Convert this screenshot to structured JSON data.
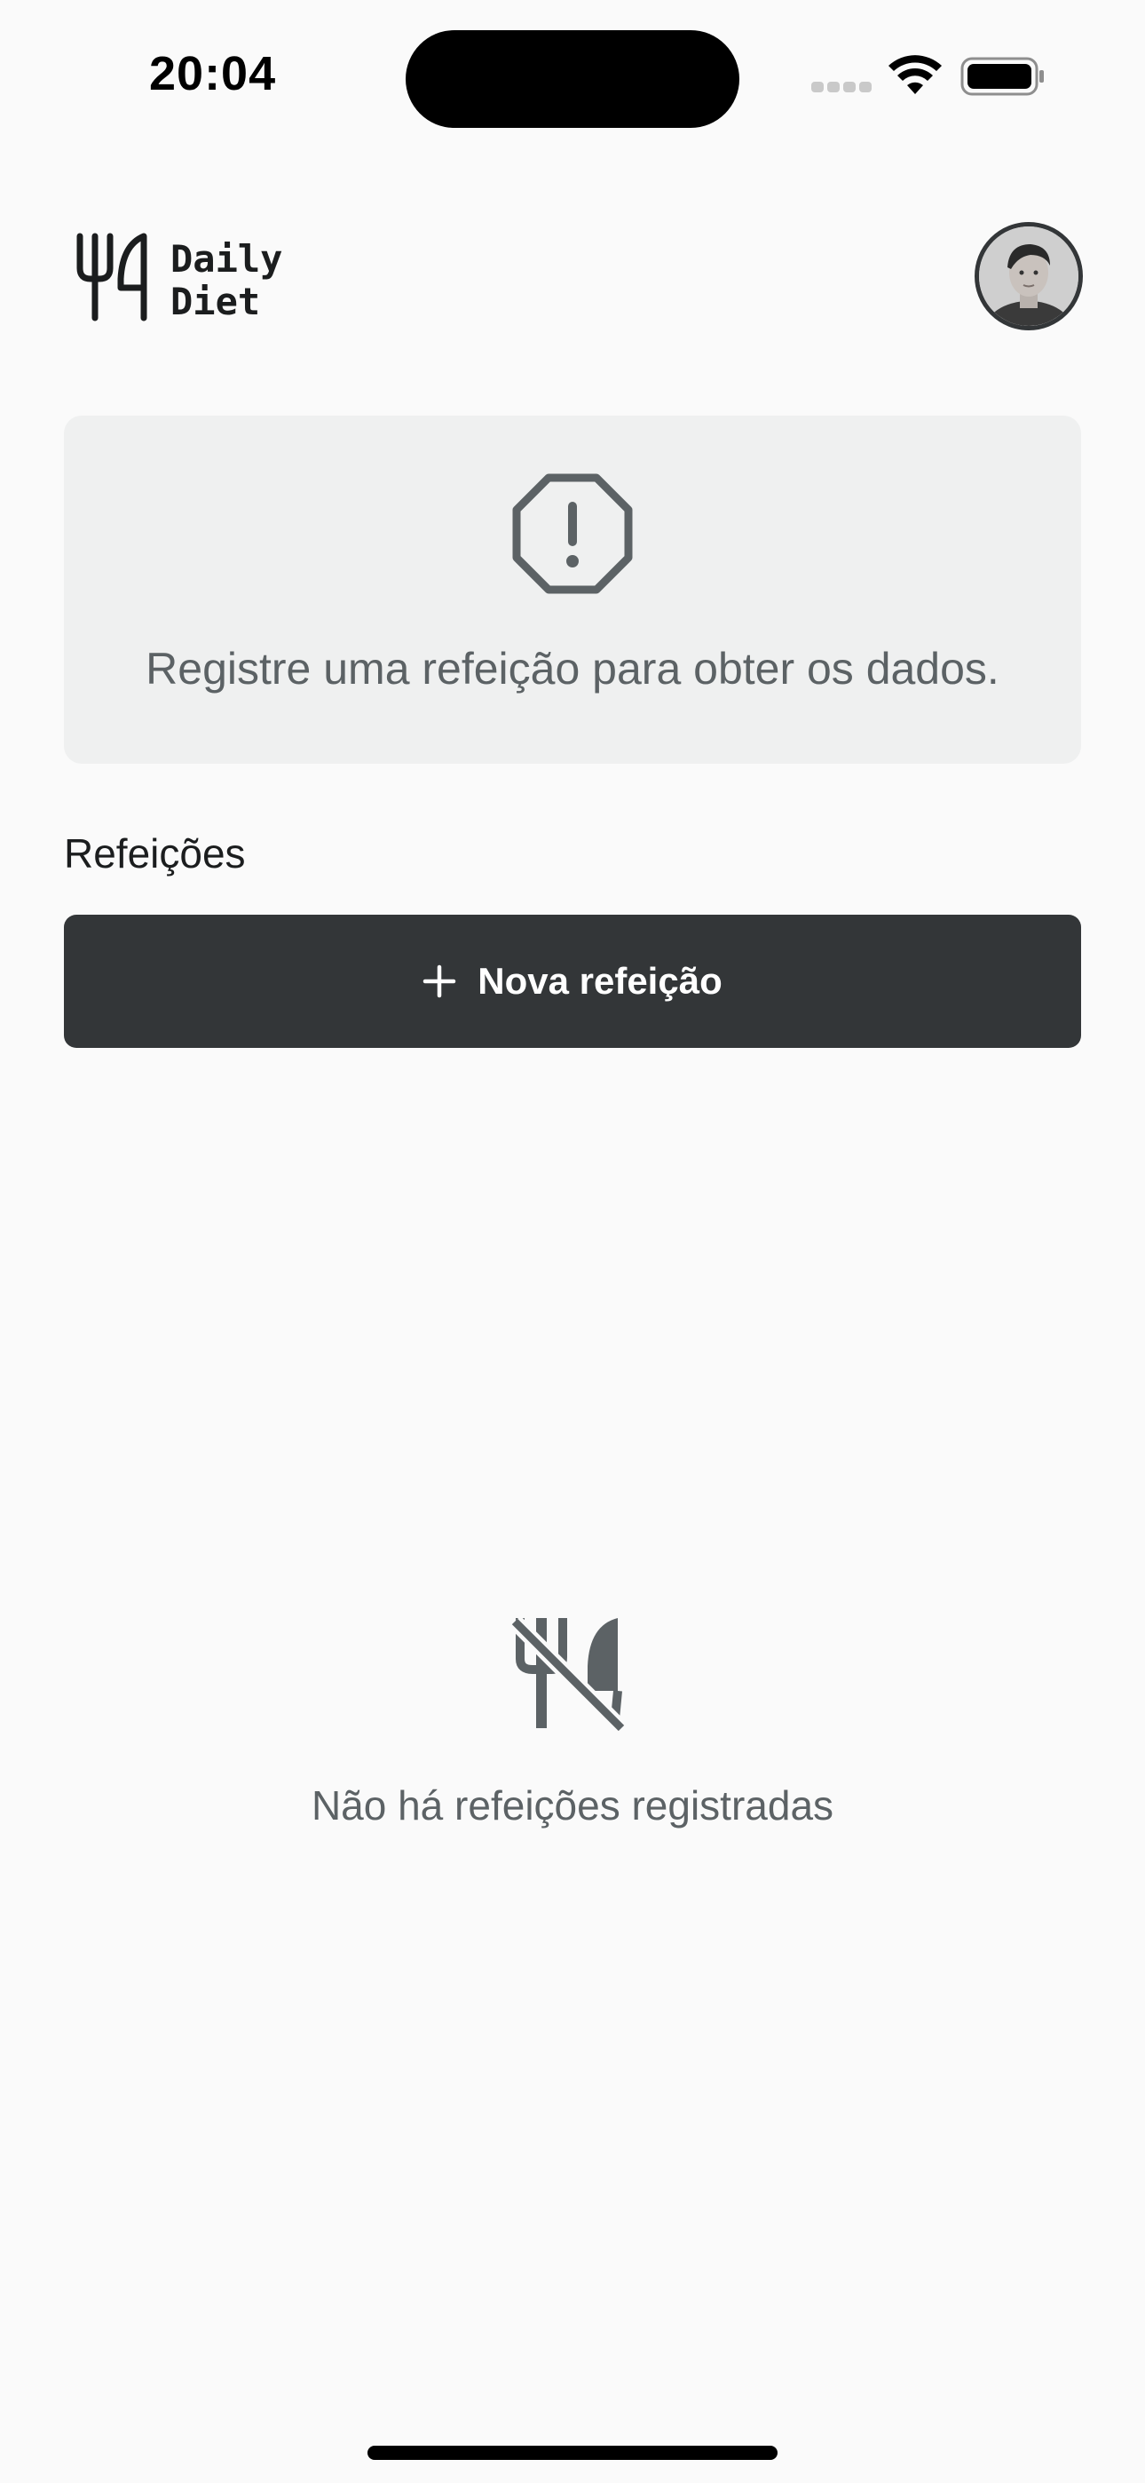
{
  "status_bar": {
    "time": "20:04",
    "icons": [
      "cellular-signal-icon",
      "wifi-icon",
      "battery-icon"
    ]
  },
  "header": {
    "logo_line1": "Daily",
    "logo_line2": "Diet",
    "logo_icon": "fork-knife-logo-icon",
    "avatar": "user-avatar"
  },
  "stats_card": {
    "icon": "warning-octagon-icon",
    "message": "Registre uma refeição para obter os dados."
  },
  "meals": {
    "section_title": "Refeições",
    "new_meal_label": "Nova refeição",
    "new_meal_icon": "plus-icon",
    "empty_icon": "no-meals-icon",
    "empty_message": "Não há refeições registradas"
  },
  "colors": {
    "background": "#FAFAFA",
    "card": "#EFF0F0",
    "button": "#333638",
    "muted_text": "#5C6265",
    "icon": "#5C6265"
  }
}
